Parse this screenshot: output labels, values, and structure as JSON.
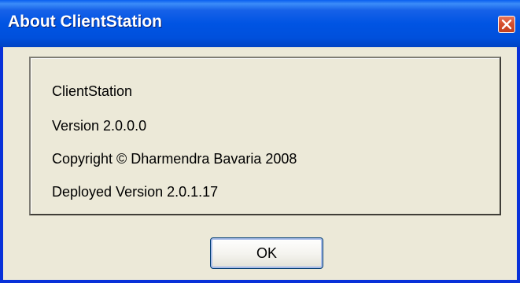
{
  "window": {
    "title": "About ClientStation",
    "titlebar_color": "#0054e3",
    "frame_color": "#ece9d8"
  },
  "titlebar": {
    "close_icon": "close-icon",
    "close_color": "#d6502f"
  },
  "info": {
    "lines": [
      "ClientStation",
      "Version 2.0.0.0",
      "Copyright © Dharmendra Bavaria 2008",
      "Deployed Version 2.0.1.17"
    ]
  },
  "buttons": {
    "ok_label": "OK"
  }
}
